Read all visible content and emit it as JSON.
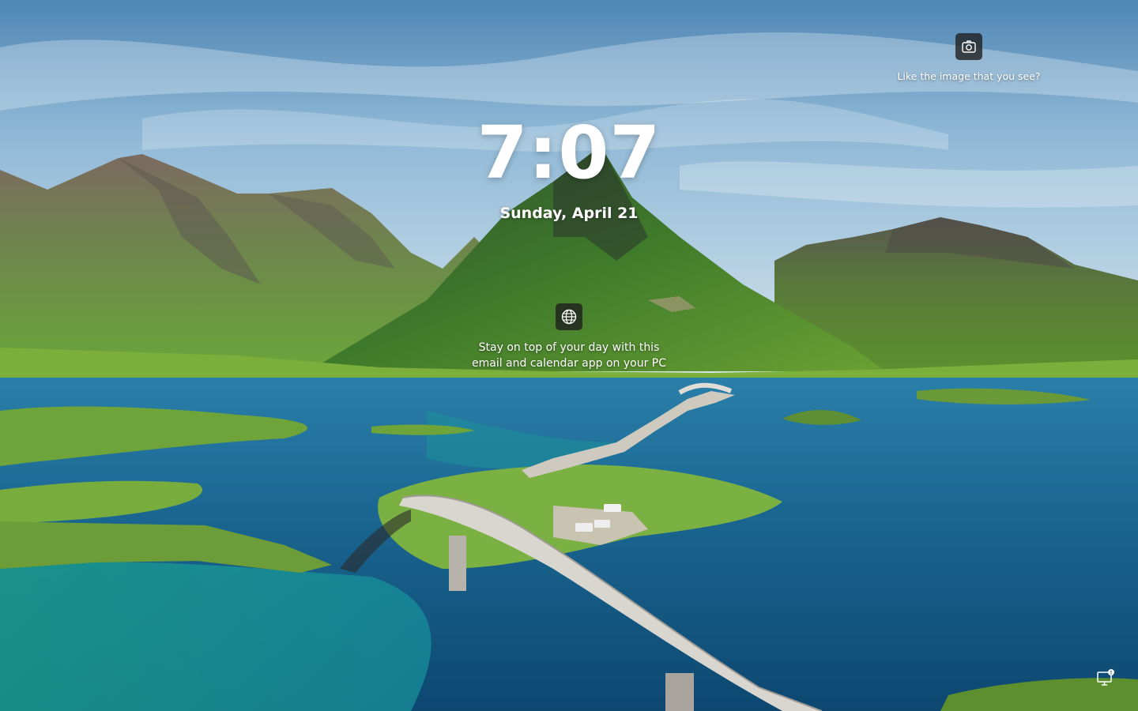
{
  "lock_screen": {
    "time": "7:07",
    "date": "Sunday, April 21",
    "spotlight": {
      "icon": "camera-icon",
      "prompt": "Like the image that you see?"
    },
    "widget": {
      "icon": "globe-icon",
      "line1": "Stay on top of your day with this",
      "line2": "email and calendar app on your PC"
    },
    "network_status": {
      "icon": "network-icon"
    }
  }
}
